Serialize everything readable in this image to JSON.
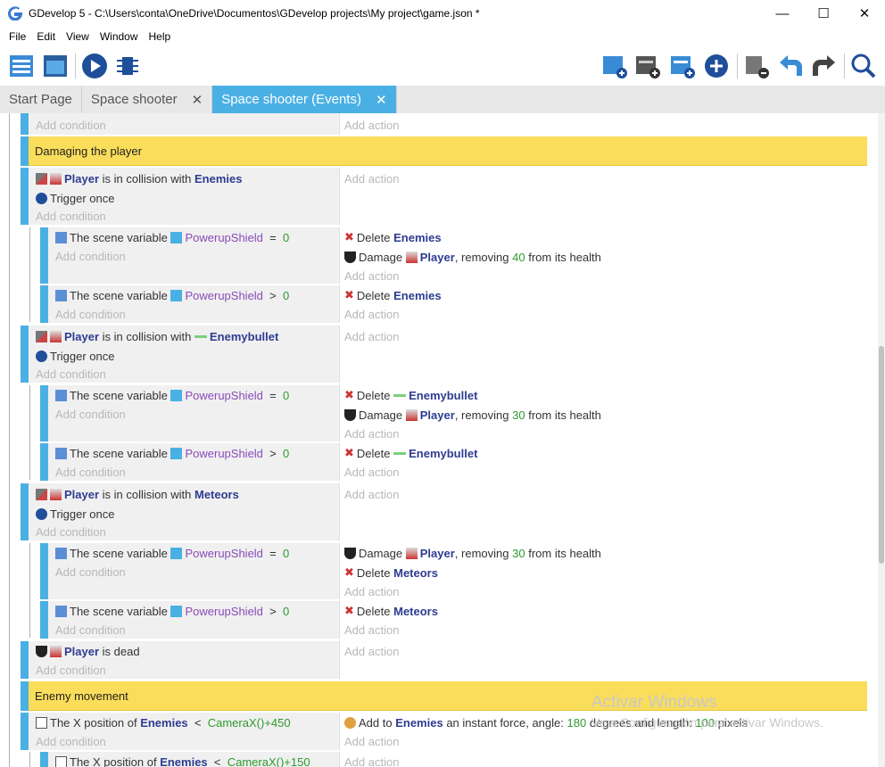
{
  "window": {
    "title": "GDevelop 5 - C:\\Users\\conta\\OneDrive\\Documentos\\GDevelop projects\\My project\\game.json *",
    "minimize": "—",
    "maximize": "☐",
    "close": "✕"
  },
  "menu": [
    "File",
    "Edit",
    "View",
    "Window",
    "Help"
  ],
  "tabs": [
    {
      "label": "Start Page"
    },
    {
      "label": "Space shooter",
      "close": "✕"
    },
    {
      "label": "Space shooter (Events)",
      "close": "✕"
    }
  ],
  "text": {
    "add_condition": "Add condition",
    "add_action": "Add action",
    "trigger_once": "Trigger once",
    "player": "Player",
    "enemies": "Enemies",
    "enemybullet": "Enemybullet",
    "meteors": "Meteors",
    "is_in_collision_with": "is in collision with",
    "the_scene_variable": "The scene variable",
    "powerup": "PowerupShield",
    "eq": "=",
    "gt": ">",
    "zero": "0",
    "delete": "Delete",
    "damage": "Damage",
    "removing": ", removing",
    "from_health": "from its health",
    "n40": "40",
    "n30": "30",
    "is_dead": "is dead",
    "the_x_position_of": "The X position of",
    "lt": "<",
    "camx450": "CameraX()+450",
    "camx150": "CameraX()+150",
    "add_to": "Add to",
    "instant_force": "an instant force, angle:",
    "n180": "180",
    "degrees_length": "degrees and length:",
    "n100": "100",
    "pixels": "pixels"
  },
  "groups": {
    "damaging": "Damaging the player",
    "enemy_movement": "Enemy movement"
  },
  "watermark": {
    "title": "Activar Windows",
    "sub": "Ve a Configuración para activar Windows."
  },
  "colors": {
    "accent": "#4ab0e4",
    "group": "#fadd5a",
    "object": "#2e3c90",
    "variable": "#8a4bb8",
    "number": "#2e9a2e"
  }
}
